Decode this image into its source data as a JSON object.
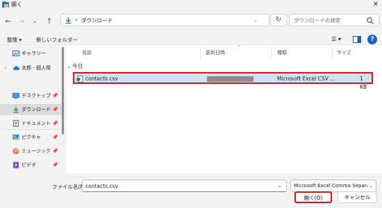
{
  "window": {
    "title": "開く",
    "close_glyph": "✕"
  },
  "toolbar": {
    "back_glyph": "←",
    "forward_glyph": "→",
    "history_glyph": "⌄",
    "up_glyph": "↑",
    "breadcrumb_sep": "›",
    "path": "ダウンロード",
    "address_dropdown_glyph": "⌄",
    "refresh_glyph": "↻",
    "search_placeholder": "ダウンロードの検索",
    "organize_label": "整理 ▾",
    "new_folder_label": "新しいフォルダー",
    "view_glyph": "☰ ▾",
    "help_glyph": "?"
  },
  "nav": {
    "items": [
      {
        "label": "ギャラリー",
        "icon": "gallery-icon",
        "expander": "",
        "pinned": false
      },
      {
        "label": "太郎 - 個人用",
        "icon": "cloud-icon",
        "expander": "›",
        "pinned": false
      },
      {
        "label": "デスクトップ",
        "icon": "desktop-icon",
        "expander": "",
        "pinned": true
      },
      {
        "label": "ダウンロード",
        "icon": "download-icon",
        "expander": "",
        "pinned": true
      },
      {
        "label": "ドキュメント",
        "icon": "document-icon",
        "expander": "",
        "pinned": true
      },
      {
        "label": "ピクチャ",
        "icon": "pictures-icon",
        "expander": "",
        "pinned": true
      },
      {
        "label": "ミュージック",
        "icon": "music-icon",
        "expander": "",
        "pinned": true
      },
      {
        "label": "ビデオ",
        "icon": "video-icon",
        "expander": "",
        "pinned": true
      }
    ],
    "pin_glyph": "📌"
  },
  "list": {
    "sort_glyph": "⌃",
    "columns": {
      "name": "名前",
      "date": "更新日時",
      "type": "種類",
      "size": "サイズ"
    },
    "group_label": "今日",
    "group_glyph": "⌄",
    "rows": [
      {
        "name": "contacts.csv",
        "date": "",
        "type": "Microsoft Excel CSV ...",
        "size": "1 KB"
      }
    ]
  },
  "footer": {
    "filename_label": "ファイル名(N):",
    "filename_value": "contacts.csv",
    "filetype_value": "Microsoft Excel Comma Separat",
    "open_label": "開く(O)",
    "cancel_label": "キャンセル"
  },
  "colors": {
    "accent": "#0067c0",
    "selection": "#cce4f7",
    "highlight_box": "#d8141b"
  }
}
